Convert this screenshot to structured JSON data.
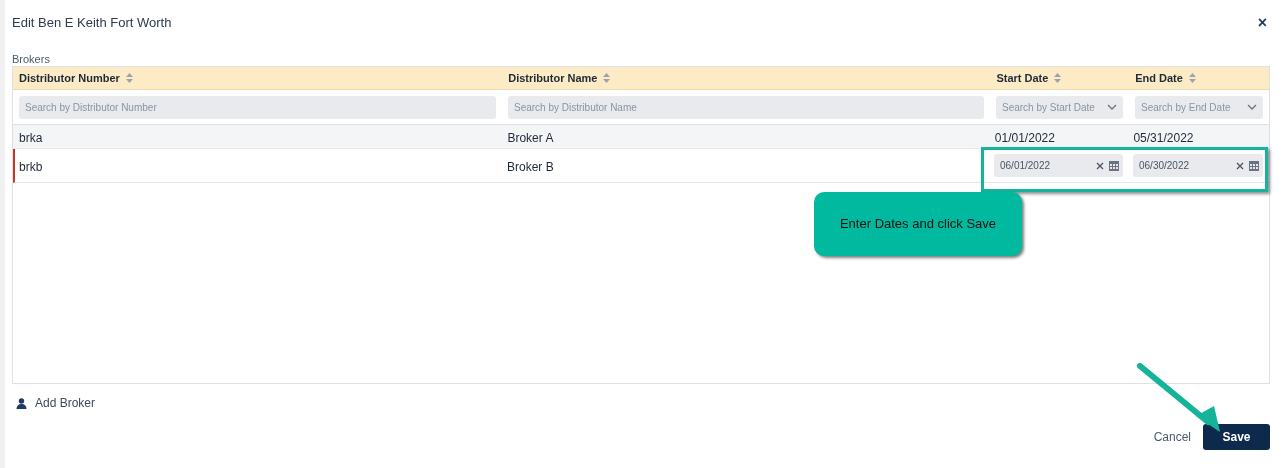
{
  "dialog": {
    "title": "Edit Ben E Keith Fort Worth",
    "close": "×"
  },
  "section_label": "Brokers",
  "table": {
    "columns": [
      {
        "label": "Distributor Number"
      },
      {
        "label": "Distributor Name"
      },
      {
        "label": "Start Date"
      },
      {
        "label": "End Date"
      }
    ],
    "filters": [
      {
        "kind": "text",
        "placeholder": "Search by Distributor Number"
      },
      {
        "kind": "text",
        "placeholder": "Search by Distributor Name"
      },
      {
        "kind": "select",
        "placeholder": "Search by Start Date"
      },
      {
        "kind": "select",
        "placeholder": "Search by End Date"
      }
    ],
    "rows": [
      {
        "kind": "view",
        "selected": false,
        "cells": [
          "brka",
          "Broker A",
          "01/01/2022",
          "05/31/2022"
        ]
      },
      {
        "kind": "edit",
        "selected": true,
        "cells": [
          "brkb",
          "Broker B",
          "06/01/2022",
          "06/30/2022"
        ]
      }
    ]
  },
  "annotation": {
    "text": "Enter Dates and click Save"
  },
  "add_link": "Add Broker",
  "buttons": {
    "cancel": "Cancel",
    "save": "Save"
  }
}
